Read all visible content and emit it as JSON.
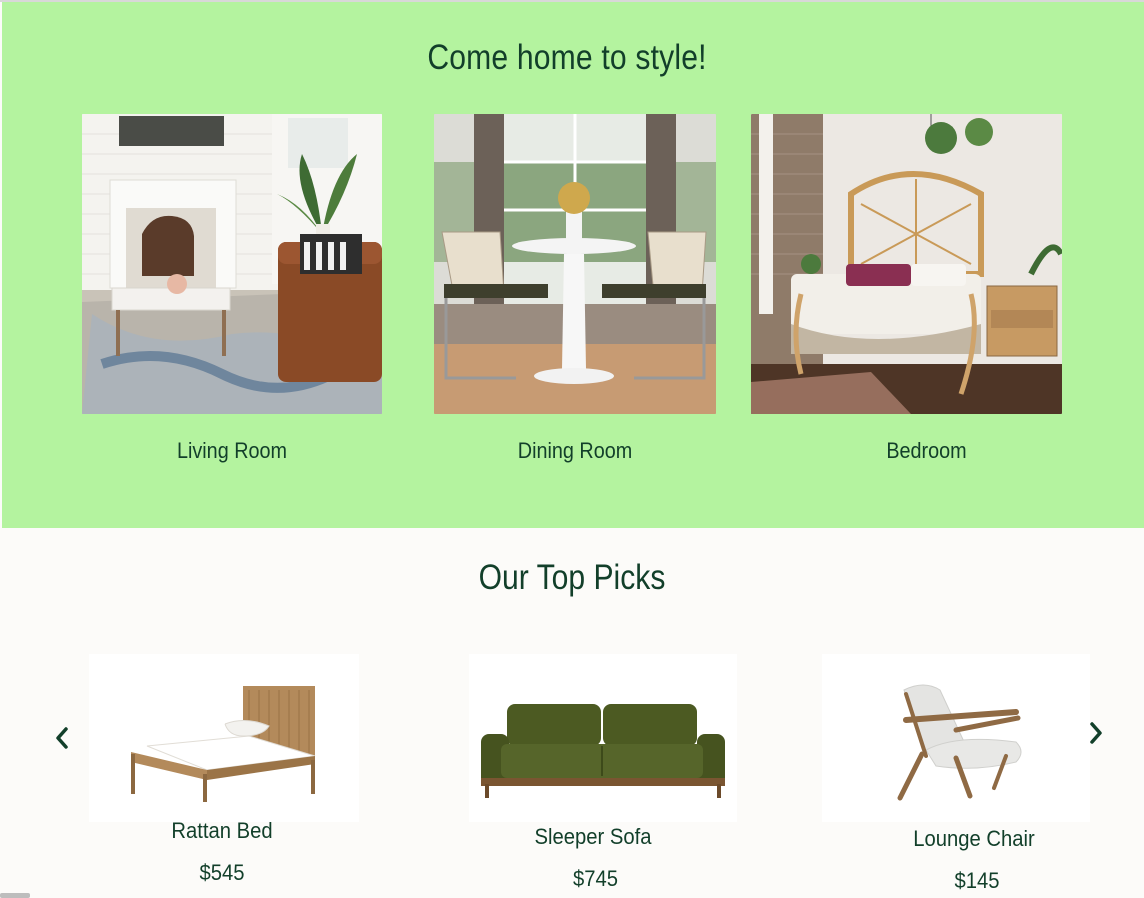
{
  "hero": {
    "title": "Come home to style!",
    "rooms": [
      {
        "label": "Living Room"
      },
      {
        "label": "Dining Room"
      },
      {
        "label": "Bedroom"
      }
    ]
  },
  "top_picks": {
    "title": "Our Top Picks",
    "prev_icon": "chevron-left-icon",
    "next_icon": "chevron-right-icon",
    "products": [
      {
        "name": "Rattan Bed",
        "price": "$545"
      },
      {
        "name": "Sleeper Sofa",
        "price": "$745"
      },
      {
        "name": "Lounge Chair",
        "price": "$145"
      }
    ]
  },
  "colors": {
    "hero_background": "#b4f39f",
    "text": "#123f2a",
    "page_background": "#fcfbf9"
  }
}
